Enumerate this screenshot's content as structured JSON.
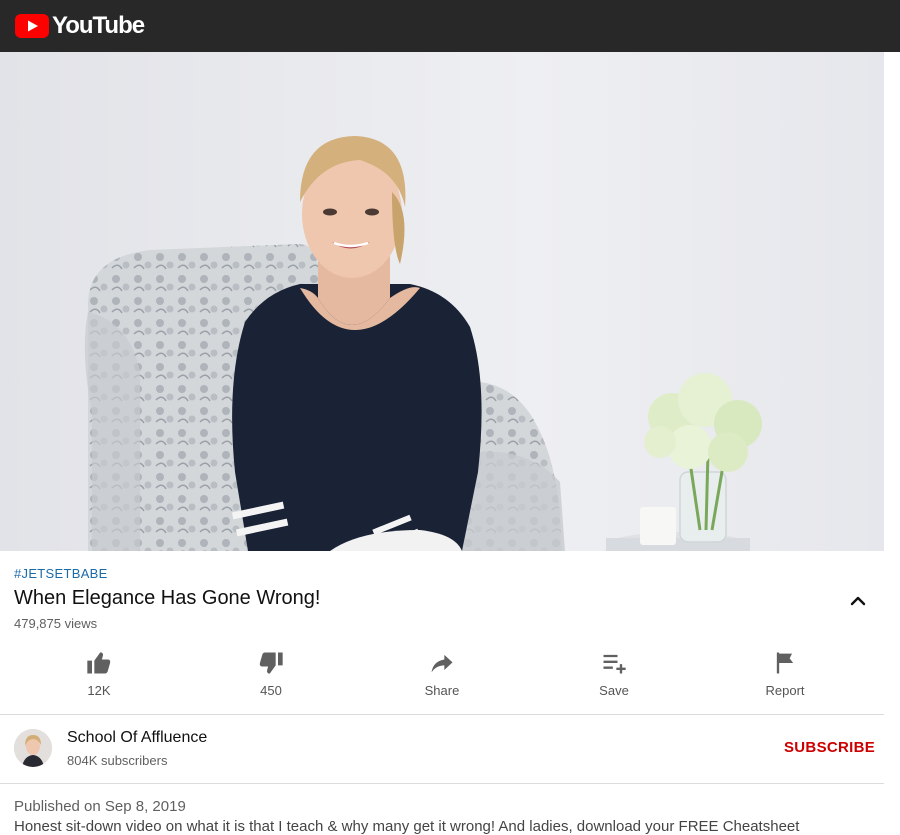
{
  "app": {
    "logo_text": "YouTube",
    "brand_color": "#ff0000",
    "header_bg": "#282828"
  },
  "video": {
    "hashtag": "#JETSETBABE",
    "title": "When Elegance Has Gone Wrong!",
    "views": "479,875 views",
    "expand_icon": "chevron-up-icon"
  },
  "actions": [
    {
      "icon": "thumbs-up-icon",
      "label": "12K"
    },
    {
      "icon": "thumbs-down-icon",
      "label": "450"
    },
    {
      "icon": "share-icon",
      "label": "Share"
    },
    {
      "icon": "playlist-add-icon",
      "label": "Save"
    },
    {
      "icon": "flag-icon",
      "label": "Report"
    }
  ],
  "channel": {
    "name": "School Of Affluence",
    "subscribers": "804K subscribers",
    "subscribe_label": "SUBSCRIBE",
    "subscribe_color": "#cc0000"
  },
  "description": {
    "published": "Published on Sep 8, 2019",
    "text": "Honest sit-down video on what it is that I teach & why many get it wrong! And ladies, download your FREE Cheatsheet"
  }
}
